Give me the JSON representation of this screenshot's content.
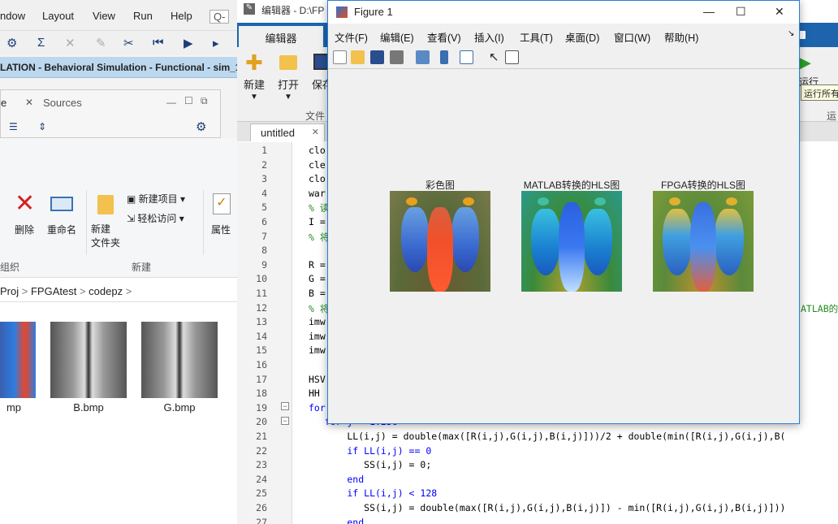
{
  "vivado": {
    "menu": [
      "ndow",
      "Layout",
      "View",
      "Run",
      "Help"
    ],
    "search_label": "Q-",
    "banner": "LATION - Behavioral Simulation - Functional - sim_1",
    "panel_tab_active": "e",
    "panel_tab_sources": "Sources"
  },
  "explorer": {
    "delete_label": "删除",
    "rename_label": "重命名",
    "new_folder_label": "新建\n文件夹",
    "new_item_label": "新建项目",
    "easy_access_label": "轻松访问",
    "properties_label": "属性",
    "group_organize": "组织",
    "group_new": "新建",
    "breadcrumb": [
      "Proj",
      "FPGAtest",
      "codepz"
    ],
    "files": [
      "mp",
      "B.bmp",
      "G.bmp"
    ]
  },
  "matlab": {
    "title": "编辑器 - D:\\FP",
    "tab_editor": "编辑器",
    "ribbon": {
      "new": "新建",
      "open": "打开",
      "save": "保存",
      "file_group": "文件",
      "run": "运行",
      "run_section": "运"
    },
    "tooltip": "运行所有",
    "doc_tab": "untitled",
    "lines": [
      {
        "n": "1",
        "text": "clo"
      },
      {
        "n": "2",
        "text": "cle"
      },
      {
        "n": "3",
        "text": "clo"
      },
      {
        "n": "4",
        "text": "war"
      },
      {
        "n": "5",
        "text": "% 读"
      },
      {
        "n": "6",
        "text": "I ="
      },
      {
        "n": "7",
        "text": "% 将"
      },
      {
        "n": "8",
        "text": ""
      },
      {
        "n": "9",
        "text": "R ="
      },
      {
        "n": "10",
        "text": "G ="
      },
      {
        "n": "11",
        "text": "B ="
      },
      {
        "n": "12",
        "text": "% 将"
      },
      {
        "n": "13",
        "text": "imw"
      },
      {
        "n": "14",
        "text": "imw"
      },
      {
        "n": "15",
        "text": "imw"
      },
      {
        "n": "16",
        "text": ""
      },
      {
        "n": "17",
        "text": "HSV"
      },
      {
        "n": "18",
        "text": "HH"
      },
      {
        "n": "19",
        "text": "for"
      },
      {
        "n": "20",
        "text": "    for j = 1:256"
      },
      {
        "n": "21",
        "text": "        LL(i,j) = double(max([R(i,j),G(i,j),B(i,j)]))/2 + double(min([R(i,j),G(i,j),B("
      },
      {
        "n": "22",
        "text": "        if LL(i,j) == 0"
      },
      {
        "n": "23",
        "text": "           SS(i,j) = 0;"
      },
      {
        "n": "24",
        "text": "        end"
      },
      {
        "n": "25",
        "text": "        if LL(i,j) < 128"
      },
      {
        "n": "26",
        "text": "           SS(i,j) = double(max([R(i,j),G(i,j),B(i,j)]) - min([R(i,j),G(i,j),B(i,j)]))"
      },
      {
        "n": "27",
        "text": "        end"
      }
    ],
    "right_comment": "ATLAB的"
  },
  "figure": {
    "title": "Figure 1",
    "menu": [
      "文件(F)",
      "编辑(E)",
      "查看(V)",
      "插入(I)",
      "工具(T)",
      "桌面(D)",
      "窗口(W)",
      "帮助(H)"
    ],
    "subplots": [
      "彩色图",
      "MATLAB转换的HLS图",
      "FPGA转换的HLS图"
    ]
  }
}
